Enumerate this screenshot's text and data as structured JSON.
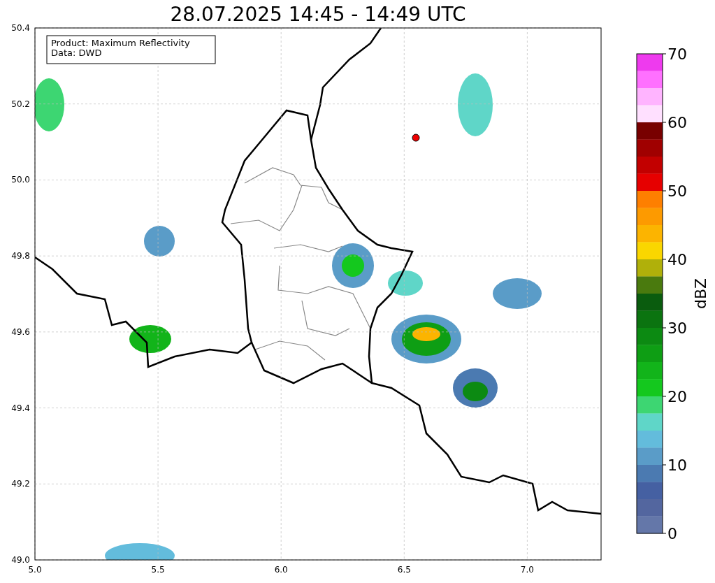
{
  "title": "28.07.2025 14:45 - 14:49 UTC",
  "legend": [
    "Product: Maximum Reflectivity",
    "Data: DWD"
  ],
  "x_axis": {
    "ticks": [
      "5.0",
      "5.5",
      "6.0",
      "6.5",
      "7.0"
    ]
  },
  "y_axis": {
    "ticks": [
      "50.4",
      "50.2",
      "50.0",
      "49.8",
      "49.6",
      "49.4",
      "49.2",
      "49.0"
    ]
  },
  "colorbar": {
    "label": "dBZ",
    "ticks": [
      "70",
      "60",
      "50",
      "40",
      "30",
      "20",
      "10",
      "0"
    ],
    "segments": [
      {
        "color": "#ee3aee"
      },
      {
        "color": "#ff70ff"
      },
      {
        "color": "#ffb4ff"
      },
      {
        "color": "#ffe0ff"
      },
      {
        "color": "#780000"
      },
      {
        "color": "#a00000"
      },
      {
        "color": "#c20000"
      },
      {
        "color": "#e60000"
      },
      {
        "color": "#fe7f00"
      },
      {
        "color": "#fd9a00"
      },
      {
        "color": "#fcb400"
      },
      {
        "color": "#fad600"
      },
      {
        "color": "#b0b00a"
      },
      {
        "color": "#4a7a0e"
      },
      {
        "color": "#0a5c0e"
      },
      {
        "color": "#0b7410"
      },
      {
        "color": "#0c8a12"
      },
      {
        "color": "#0e9e14"
      },
      {
        "color": "#12b41a"
      },
      {
        "color": "#14c81e"
      },
      {
        "color": "#3dd672"
      },
      {
        "color": "#5fd6c8"
      },
      {
        "color": "#63bcdc"
      },
      {
        "color": "#5a9cc8"
      },
      {
        "color": "#4b7ab1"
      },
      {
        "color": "#4560a2"
      },
      {
        "color": "#53669f"
      },
      {
        "color": "#6477a9"
      }
    ]
  }
}
